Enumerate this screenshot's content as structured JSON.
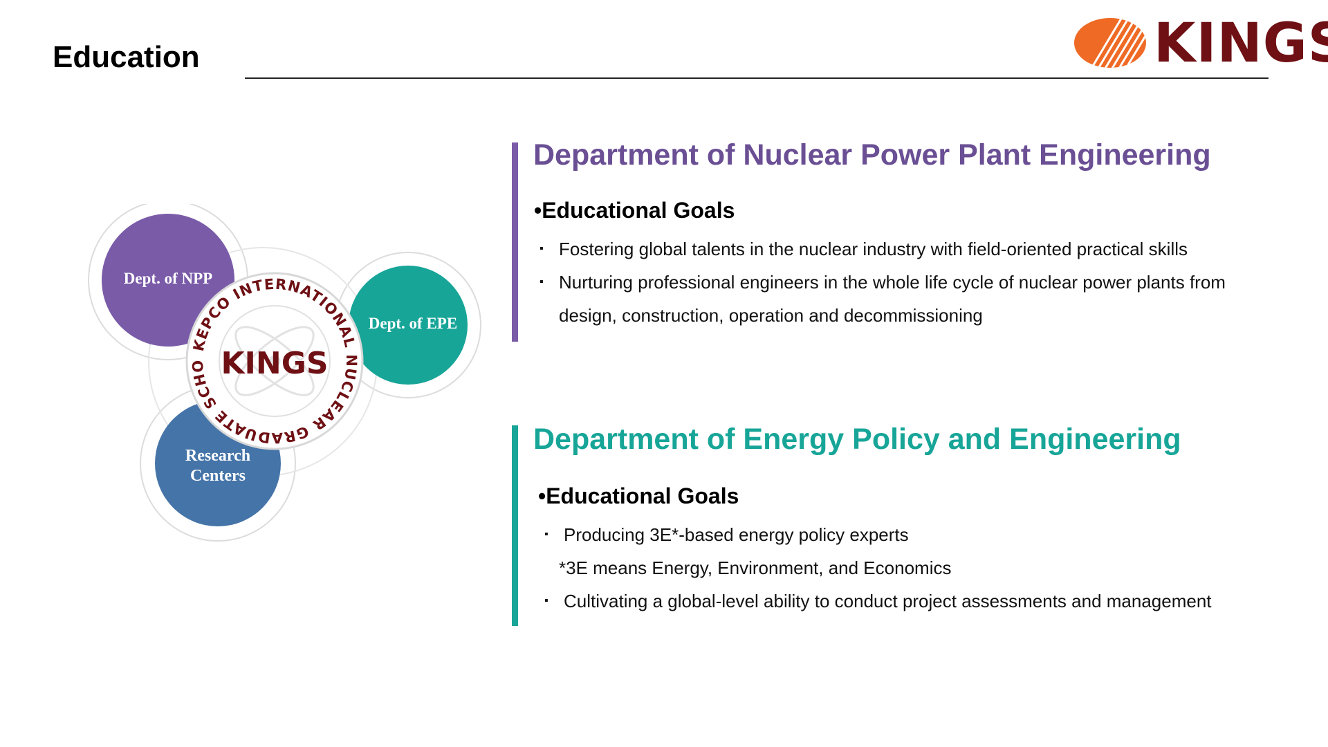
{
  "header": {
    "title": "Education",
    "logo_text": "KINGS"
  },
  "colors": {
    "npp": "#7a5ba8",
    "npp_title": "#6a4f94",
    "epe": "#17a598",
    "research": "#4574a8",
    "logo_orange": "#ef6a25",
    "logo_maroon": "#6e1014"
  },
  "diagram": {
    "npp_label": "Dept. of NPP",
    "epe_label": "Dept. of EPE",
    "research_line1": "Research",
    "research_line2": "Centers",
    "seal_center": "KINGS",
    "seal_ring_text": "KEPCO INTERNATIONAL NUCLEAR GRADUATE SCHOOL"
  },
  "npp_section": {
    "title": "Department of Nuclear Power Plant Engineering",
    "goals_heading": "•Educational Goals",
    "bullets": [
      "Fostering global talents in the nuclear industry with field-oriented practical skills",
      "Nurturing professional engineers in the whole life cycle of nuclear power plants from",
      "design, construction, operation and decommissioning"
    ]
  },
  "epe_section": {
    "title": "Department of Energy Policy and Engineering",
    "goals_heading": "•Educational Goals",
    "bullets": [
      "Producing 3E*-based energy policy experts",
      "*3E means Energy, Environment, and Economics",
      "Cultivating a global-level ability to conduct project assessments and management"
    ]
  },
  "bullet_symbol": "▪"
}
